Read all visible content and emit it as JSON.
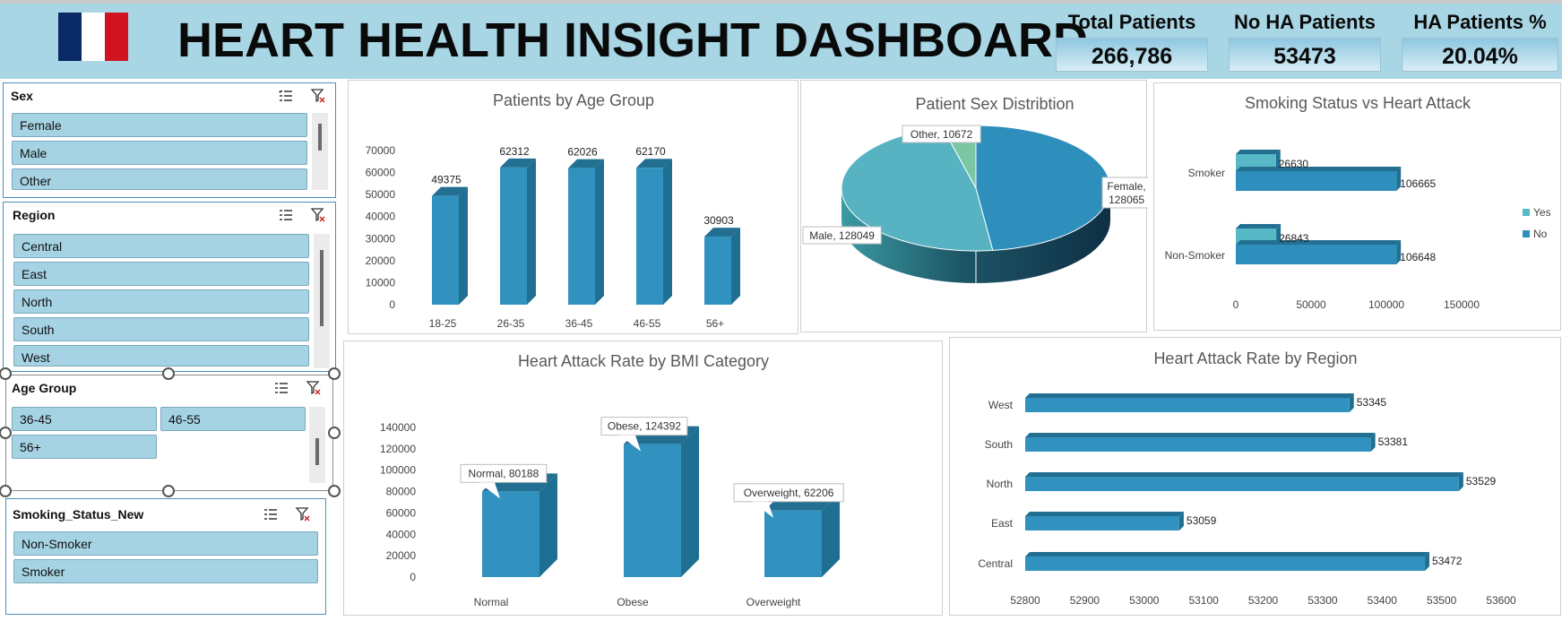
{
  "header": {
    "title": "HEART HEALTH INSIGHT DASHBOARD",
    "flag_colors": [
      "#0a2a66",
      "#ffffff",
      "#d0141f"
    ],
    "kpis": [
      {
        "label": "Total Patients",
        "value": "266,786"
      },
      {
        "label": "No HA Patients",
        "value": "53473"
      },
      {
        "label": "HA Patients %",
        "value": "20.04%"
      }
    ]
  },
  "slicers": {
    "sex": {
      "title": "Sex",
      "items": [
        "Female",
        "Male",
        "Other"
      ]
    },
    "region": {
      "title": "Region",
      "items": [
        "Central",
        "East",
        "North",
        "South",
        "West"
      ]
    },
    "age_group": {
      "title": "Age Group",
      "items": [
        "36-45",
        "46-55",
        "56+"
      ]
    },
    "smoking": {
      "title": "Smoking_Status_New",
      "items": [
        "Non-Smoker",
        "Smoker"
      ]
    },
    "icons": [
      "multi-select-icon",
      "clear-filter-icon"
    ]
  },
  "colors": {
    "bar": "#3192bf",
    "bar_dark": "#1f6f93",
    "bar_top": "#226f92",
    "yes": "#57b9c6",
    "no": "#2e8fbd",
    "header_bg": "#a9d6e5"
  },
  "chart_data": [
    {
      "id": "age",
      "type": "bar",
      "title": "Patients by Age Group",
      "categories": [
        "18-25",
        "26-35",
        "36-45",
        "46-55",
        "56+"
      ],
      "values": [
        49375,
        62312,
        62026,
        62170,
        30903
      ],
      "data_labels": [
        "49375",
        "62312",
        "62026",
        "62170",
        "30903"
      ],
      "yticks": [
        "0",
        "10000",
        "20000",
        "30000",
        "40000",
        "50000",
        "60000",
        "70000"
      ],
      "ylim": [
        0,
        70000
      ]
    },
    {
      "id": "sex",
      "type": "pie",
      "title": "Patient Sex Distribtion",
      "slices": [
        {
          "name": "Female",
          "value": 128065,
          "color": "#2e8fbd"
        },
        {
          "name": "Male",
          "value": 128049,
          "color": "#57b3c1"
        },
        {
          "name": "Other",
          "value": 10672,
          "color": "#7cc6a4"
        }
      ],
      "labels": {
        "female_1": "Female,",
        "female_2": "128065",
        "male": "Male, 128049",
        "other": "Other, 10672"
      }
    },
    {
      "id": "smoking",
      "type": "bar",
      "orientation": "horizontal",
      "title": "Smoking Status vs Heart Attack",
      "categories": [
        "Smoker",
        "Non-Smoker"
      ],
      "series": [
        {
          "name": "Yes",
          "values": [
            26630,
            26843
          ]
        },
        {
          "name": "No",
          "values": [
            106665,
            106648
          ]
        }
      ],
      "data_labels": {
        "yes": [
          "26630",
          "26843"
        ],
        "no": [
          "106665",
          "106648"
        ]
      },
      "xticks": [
        "0",
        "50000",
        "100000",
        "150000"
      ],
      "xlim": [
        0,
        150000
      ],
      "legend": "right"
    },
    {
      "id": "bmi",
      "type": "bar",
      "title": "Heart Attack Rate by BMI Category",
      "categories": [
        "Normal",
        "Obese",
        "Overweight"
      ],
      "values": [
        80188,
        124392,
        62206
      ],
      "data_labels": [
        "Normal, 80188",
        "Obese, 124392",
        "Overweight, 62206"
      ],
      "yticks": [
        "0",
        "20000",
        "40000",
        "60000",
        "80000",
        "100000",
        "120000",
        "140000"
      ],
      "ylim": [
        0,
        140000
      ]
    },
    {
      "id": "region",
      "type": "bar",
      "orientation": "horizontal",
      "title": "Heart Attack Rate by Region",
      "categories": [
        "West",
        "South",
        "North",
        "East",
        "Central"
      ],
      "values": [
        53345,
        53381,
        53529,
        53059,
        53472
      ],
      "data_labels": [
        "53345",
        "53381",
        "53529",
        "53059",
        "53472"
      ],
      "xticks": [
        "52800",
        "52900",
        "53000",
        "53100",
        "53200",
        "53300",
        "53400",
        "53500",
        "53600"
      ],
      "xlim": [
        52800,
        53600
      ]
    }
  ]
}
